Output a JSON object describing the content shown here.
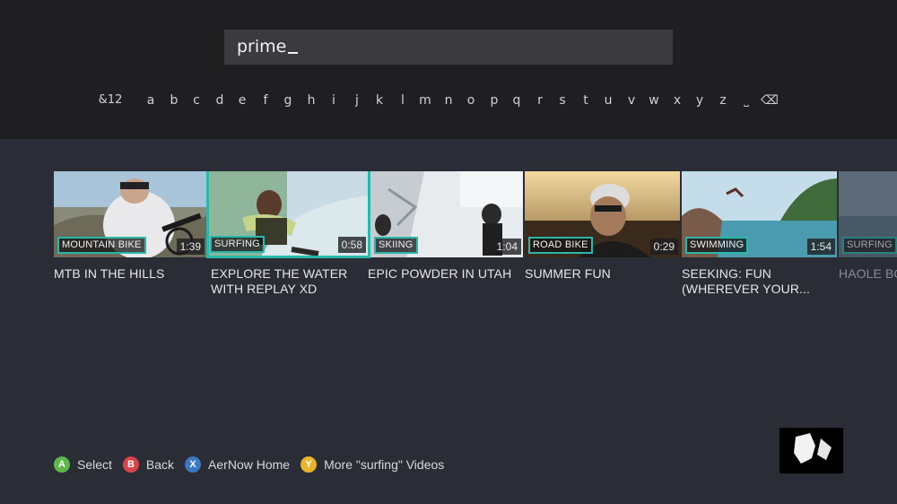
{
  "search": {
    "query": "prime"
  },
  "keyboard": {
    "keys": [
      "&12",
      "a",
      "b",
      "c",
      "d",
      "e",
      "f",
      "g",
      "h",
      "i",
      "j",
      "k",
      "l",
      "m",
      "n",
      "o",
      "p",
      "q",
      "r",
      "s",
      "t",
      "u",
      "v",
      "w",
      "x",
      "y",
      "z",
      "˽",
      "⌫"
    ]
  },
  "videos": [
    {
      "category": "MOUNTAIN BIKE",
      "duration": "1:39",
      "title": "MTB IN THE HILLS"
    },
    {
      "category": "SURFING",
      "duration": "0:58",
      "title": "EXPLORE THE WATER WITH REPLAY XD",
      "selected": true
    },
    {
      "category": "SKIING",
      "duration": "1:04",
      "title": "EPIC POWDER IN UTAH"
    },
    {
      "category": "ROAD BIKE",
      "duration": "0:29",
      "title": "SUMMER FUN"
    },
    {
      "category": "SWIMMING",
      "duration": "1:54",
      "title": "SEEKING: FUN (WHEREVER YOUR..."
    },
    {
      "category": "SURFING",
      "duration": "",
      "title": "HAOLE BO"
    }
  ],
  "hints": [
    {
      "button": "A",
      "label": "Select"
    },
    {
      "button": "B",
      "label": "Back"
    },
    {
      "button": "X",
      "label": "AerNow Home"
    },
    {
      "button": "Y",
      "label": "More \"surfing\" Videos"
    }
  ],
  "colors": {
    "accent": "#2ab7a9",
    "background": "#2b2d36",
    "header": "#1f1f22"
  }
}
